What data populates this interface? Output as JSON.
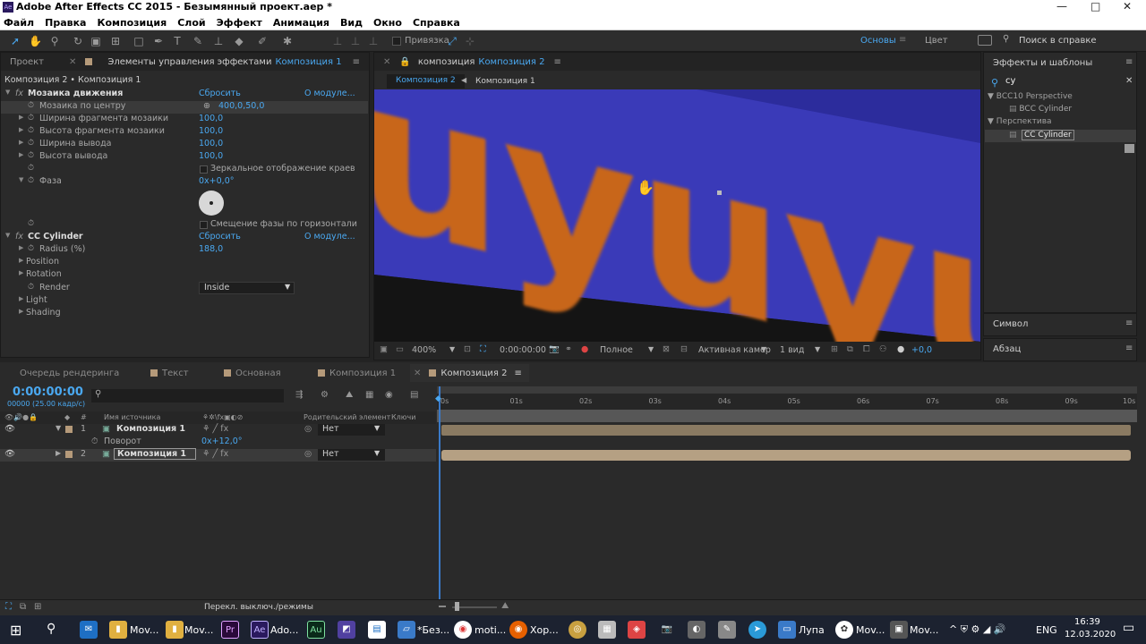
{
  "window": {
    "title": "Adobe After Effects CC 2015 - Безымянный проект.aep *",
    "min": "—",
    "max": "□",
    "close": "✕"
  },
  "menu": [
    "Файл",
    "Правка",
    "Композиция",
    "Слой",
    "Эффект",
    "Анимация",
    "Вид",
    "Окно",
    "Справка"
  ],
  "toolbar": {
    "snap_label": "Привязка",
    "workspace_active": "Основы",
    "workspace_other": "Цвет",
    "search_placeholder": "Поиск в справке"
  },
  "project_tab": "Проект",
  "effect_controls": {
    "tab": "Элементы управления эффектами",
    "tab_comp": "Композиция 1",
    "breadcrumb": "Композиция 2 • Композиция 1",
    "mosaic": {
      "name": "Мозаика движения",
      "reset": "Сбросить",
      "about": "О модуле...",
      "rows": [
        {
          "label": "Мозаика по центру",
          "value": "400,0,50,0"
        },
        {
          "label": "Ширина фрагмента мозаики",
          "value": "100,0"
        },
        {
          "label": "Высота фрагмента мозаики",
          "value": "100,0"
        },
        {
          "label": "Ширина вывода",
          "value": "100,0"
        },
        {
          "label": "Высота вывода",
          "value": "100,0"
        }
      ],
      "mirror": "Зеркальное отображение краев",
      "phase_label": "Фаза",
      "phase_value": "0x+0,0°",
      "phase_shift": "Смещение фазы по горизонтали"
    },
    "cylinder": {
      "name": "CC Cylinder",
      "reset": "Сбросить",
      "about": "О модуле...",
      "radius_label": "Radius (%)",
      "radius_value": "188,0",
      "position": "Position",
      "rotation": "Rotation",
      "render_label": "Render",
      "render_value": "Inside",
      "light": "Light",
      "shading": "Shading"
    }
  },
  "composition": {
    "tab_prefix": "композиция",
    "tab_name": "Композиция 2",
    "flow_active": "Композиция 2",
    "flow_other": "Композиция 1",
    "zoom": "400%",
    "timecode": "0:00:00:00",
    "quality": "Полное",
    "camera": "Активная камер",
    "views": "1 вид",
    "exposure": "+0,0",
    "text": "uyuyu"
  },
  "effects_presets": {
    "title": "Эффекты и шаблоны",
    "search": "cy",
    "groups": [
      {
        "name": "BCC10 Perspective",
        "item": "BCC Cylinder"
      },
      {
        "name": "Перспектива",
        "item": "CC Cylinder"
      }
    ]
  },
  "side_panels": [
    "Символ",
    "Абзац"
  ],
  "timeline": {
    "tabs": [
      "Очередь рендеринга",
      "Текст",
      "Основная",
      "Композиция 1",
      "Композиция 2"
    ],
    "timecode": "0:00:00:00",
    "fps": "00000 (25.00 кадр/с)",
    "col_source": "Имя источника",
    "col_parent": "Родительский элемент",
    "col_keys": "Ключи",
    "layers": [
      {
        "num": "1",
        "name": "Композиция 1",
        "parent": "Нет"
      },
      {
        "num": "2",
        "name": "Композиция 1",
        "parent": "Нет"
      }
    ],
    "rotation_label": "Поворот",
    "rotation_value": "0x+12,0°",
    "ruler": [
      "0s",
      "01s",
      "02s",
      "03s",
      "04s",
      "05s",
      "06s",
      "07s",
      "08s",
      "09s",
      "10s"
    ],
    "bottom_toggle": "Перекл. выключ./режимы"
  },
  "taskbar": {
    "items": [
      "Mov...",
      "Mov...",
      "Ado...",
      "*Без...",
      "moti...",
      "Хор...",
      "Лупа",
      "Mov...",
      "Mov..."
    ],
    "lang": "ENG",
    "time": "16:39",
    "date": "12.03.2020"
  }
}
